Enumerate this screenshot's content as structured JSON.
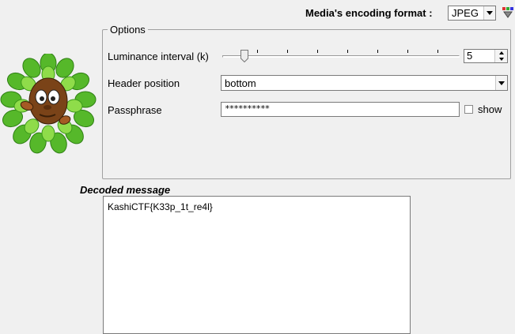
{
  "format": {
    "label": "Media's encoding format :",
    "value": "JPEG"
  },
  "options": {
    "legend": "Options",
    "luminance": {
      "label": "Luminance interval (k)",
      "value": "5"
    },
    "header_position": {
      "label": "Header position",
      "value": "bottom"
    },
    "passphrase": {
      "label": "Passphrase",
      "masked": "**********",
      "show_label": "show",
      "show_checked": false
    }
  },
  "decoded": {
    "title": "Decoded message",
    "message": "KashiCTF{K33p_1t_re4l}"
  },
  "colors": {
    "background": "#f0f0f0",
    "field": "#ffffff",
    "leaf_green": "#5fbf2a"
  }
}
